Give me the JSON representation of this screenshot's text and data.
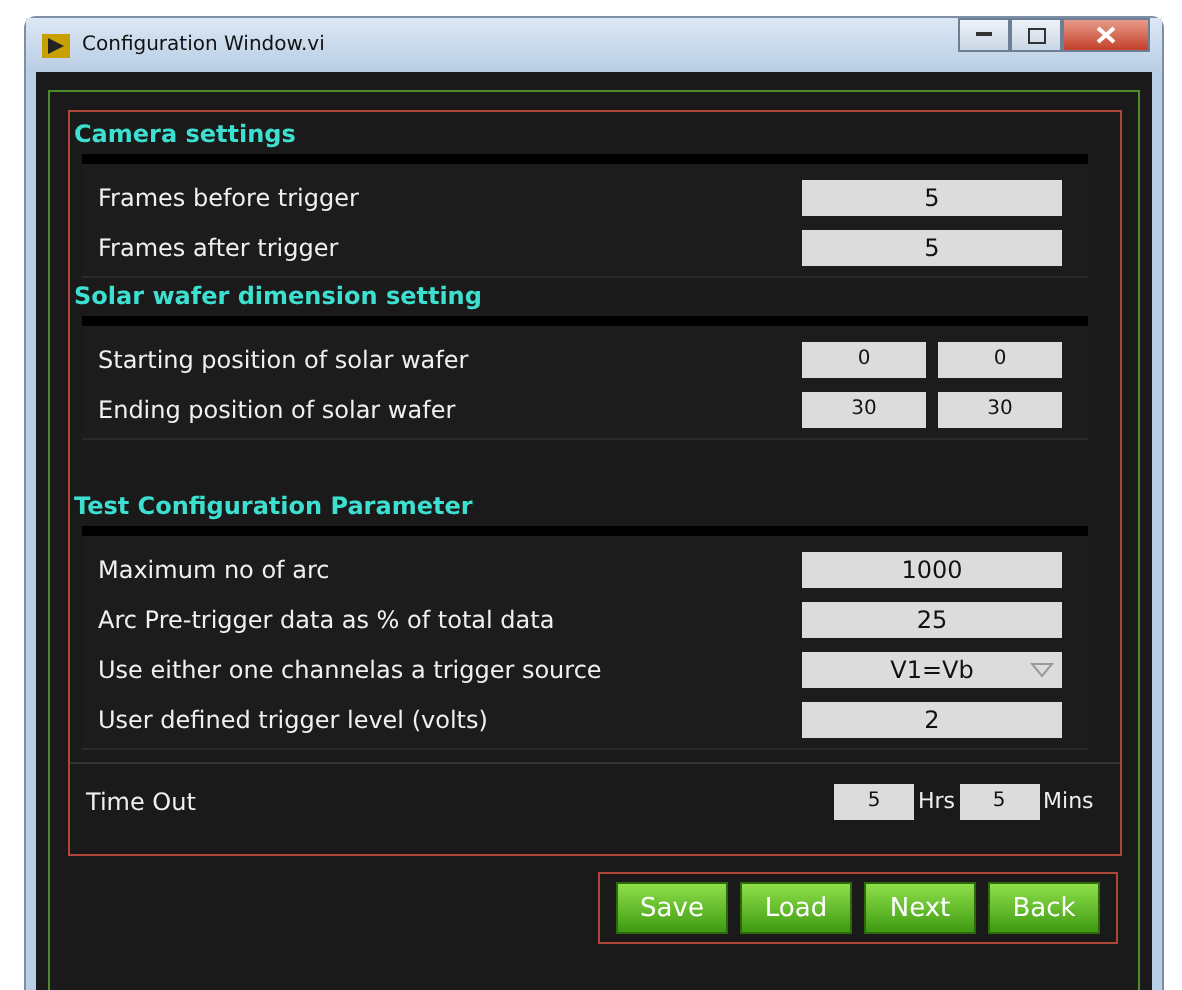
{
  "window": {
    "title": "Configuration Window.vi"
  },
  "sections": [
    {
      "heading": "Camera settings",
      "rows": [
        {
          "kind": "field",
          "label": "Frames before trigger",
          "values": [
            "5"
          ]
        },
        {
          "kind": "field",
          "label": "Frames after trigger",
          "values": [
            "5"
          ]
        }
      ]
    },
    {
      "heading": "Solar wafer dimension setting",
      "rows": [
        {
          "kind": "pair",
          "label": "Starting position of solar wafer",
          "values": [
            "0",
            "0"
          ]
        },
        {
          "kind": "pair",
          "label": "Ending position of solar wafer",
          "values": [
            "30",
            "30"
          ]
        }
      ]
    },
    {
      "heading": "Test Configuration Parameter",
      "rows": [
        {
          "kind": "field",
          "label": "Maximum no of arc",
          "values": [
            "1000"
          ]
        },
        {
          "kind": "field",
          "label": "Arc Pre-trigger data as % of total data",
          "values": [
            "25"
          ]
        },
        {
          "kind": "dropdown",
          "label": "Use either one channelas a trigger source",
          "values": [
            "V1=Vb"
          ]
        },
        {
          "kind": "field",
          "label": "User defined trigger level (volts)",
          "values": [
            "2"
          ]
        }
      ]
    }
  ],
  "timeout": {
    "label": "Time Out",
    "hours": "5",
    "hours_unit": "Hrs",
    "mins": "5",
    "mins_unit": "Mins"
  },
  "buttons": [
    "Save",
    "Load",
    "Next",
    "Back"
  ]
}
